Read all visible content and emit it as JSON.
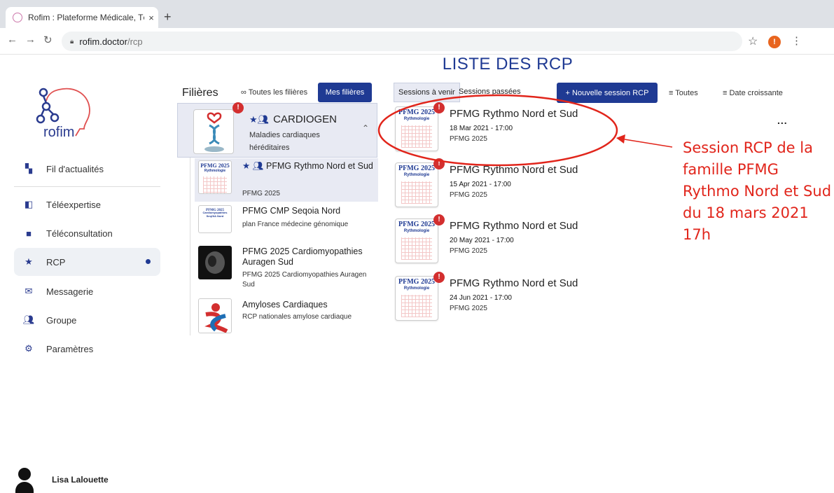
{
  "browser": {
    "tab_title": "Rofim : Plateforme Médicale, Té",
    "tab_close": "×",
    "new_tab": "+",
    "url_host": "rofim.doctor",
    "url_path": "/rcp",
    "profile_initial": "!"
  },
  "page": {
    "title": "LISTE DES RCP"
  },
  "sidebar": {
    "logo_text": "rofim",
    "items": [
      {
        "label": "Fil d'actualités",
        "icon": "dashboard-icon"
      },
      {
        "label": "Téléexpertise",
        "icon": "folder-icon"
      },
      {
        "label": "Téléconsultation",
        "icon": "video-icon"
      },
      {
        "label": "RCP",
        "icon": "star-icon"
      },
      {
        "label": "Messagerie",
        "icon": "mail-icon"
      },
      {
        "label": "Groupe",
        "icon": "group-icon"
      },
      {
        "label": "Paramètres",
        "icon": "gear-icon"
      }
    ],
    "user_name": "Lisa Lalouette"
  },
  "filieres": {
    "heading": "Filières",
    "all_label": "Toutes les filières",
    "mine_label": "Mes filières",
    "main": {
      "name": "CARDIOGEN",
      "description": "Maladies cardiaques héréditaires",
      "badge": "!"
    },
    "items": [
      {
        "title": "PFMG Rythmo Nord et Sud",
        "subtitle": "PFMG 2025",
        "thumb_label": "PFMG 2025",
        "thumb_sub": "Rythmologie"
      },
      {
        "title": "PFMG CMP Seqoia Nord",
        "subtitle": "plan France médecine génomique",
        "thumb_label": "PFMG 2025",
        "thumb_sub": "Cardiomyopathies SeqOIA Nord"
      },
      {
        "title": "PFMG 2025 Cardiomyopathies Auragen Sud",
        "subtitle": "PFMG 2025 Cardiomyopathies Auragen Sud"
      },
      {
        "title": "Amyloses Cardiaques",
        "subtitle": "RCP nationales amylose cardiaque"
      }
    ]
  },
  "sessions": {
    "upcoming_label": "Sessions à venir",
    "past_label": "Sessions passées",
    "new_label": "+ Nouvelle session RCP",
    "filter_label": "Toutes",
    "sort_label": "Date croissante",
    "more_label": "...",
    "list": [
      {
        "title": "PFMG Rythmo Nord et Sud",
        "date": "18 Mar 2021 - 17:00",
        "group": "PFMG 2025",
        "thumb_label": "PFMG 2025",
        "thumb_sub": "Rythmologie",
        "badge": "!"
      },
      {
        "title": "PFMG Rythmo Nord et Sud",
        "date": "15 Apr 2021 - 17:00",
        "group": "PFMG 2025",
        "thumb_label": "PFMG 2025",
        "thumb_sub": "Rythmologie",
        "badge": "!"
      },
      {
        "title": "PFMG Rythmo Nord et Sud",
        "date": "20 May 2021 - 17:00",
        "group": "PFMG 2025",
        "thumb_label": "PFMG 2025",
        "thumb_sub": "Rythmologie",
        "badge": "!"
      },
      {
        "title": "PFMG Rythmo Nord et Sud",
        "date": "24 Jun 2021 - 17:00",
        "group": "PFMG 2025",
        "thumb_label": "PFMG 2025",
        "thumb_sub": "Rythmologie",
        "badge": "!"
      }
    ]
  },
  "annotation": {
    "text": "Session RCP de la famille PFMG Rythmo Nord et Sud du 18 mars 2021 17h",
    "color": "#e1251b"
  },
  "colors": {
    "brand": "#1f3a93",
    "badge": "#d32f2f",
    "selected_bg": "#e8eaf3"
  }
}
